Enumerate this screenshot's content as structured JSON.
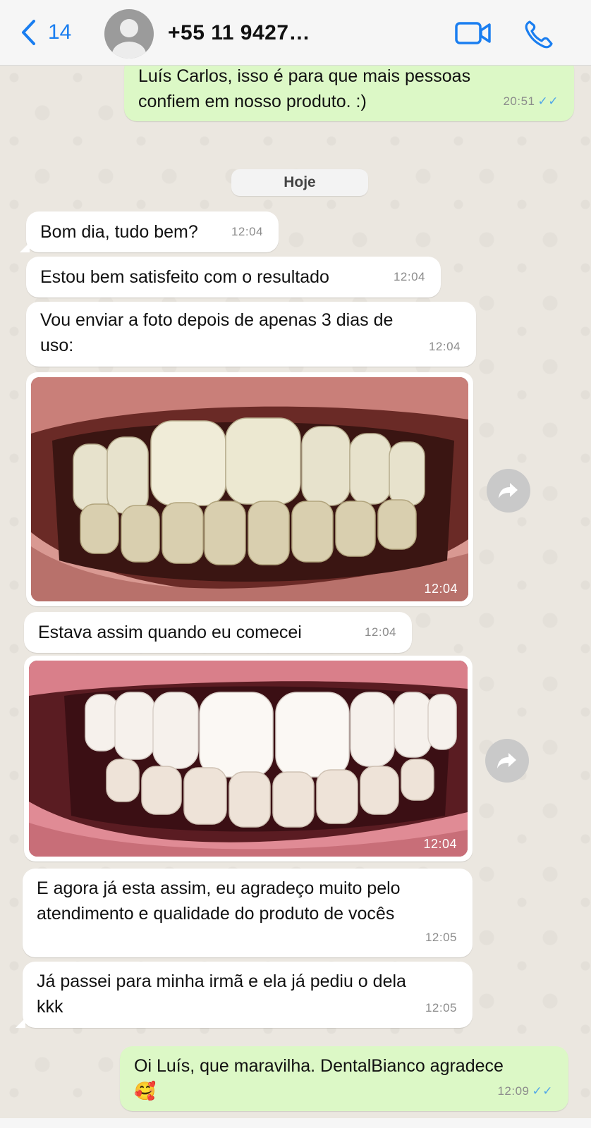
{
  "header": {
    "back_count": "14",
    "contact": "+55 11 9427…",
    "video_icon": "video-camera-icon",
    "phone_icon": "phone-icon"
  },
  "messages": {
    "m0": {
      "text_line1": "Luís Carlos, isso é para que mais pessoas",
      "text_line2": "confiem em nosso produto. :)",
      "time": "20:51",
      "ticks": "✓✓"
    },
    "date_chip": "Hoje",
    "m1": {
      "text": "Bom dia, tudo bem?",
      "time": "12:04"
    },
    "m2": {
      "text": "Estou bem satisfeito com o resultado",
      "time": "12:04"
    },
    "m3": {
      "text_line1": "Vou enviar a foto depois de apenas 3 dias de",
      "text_line2": "uso:",
      "time": "12:04"
    },
    "photo1": {
      "time": "12:04"
    },
    "m4": {
      "text": "Estava assim quando eu comecei",
      "time": "12:04"
    },
    "photo2": {
      "time": "12:04"
    },
    "m5": {
      "text_line1": "E agora já esta assim, eu agradeço muito pelo",
      "text_line2": "atendimento e qualidade do produto de vocês",
      "time": "12:05"
    },
    "m6": {
      "text_line1": "Já passei para minha irmã e ela já pediu o dela",
      "text_line2": "kkk",
      "time": "12:05"
    },
    "m7": {
      "text_line1": "Oi Luís, que maravilha. DentalBianco agradece",
      "emoji": "🥰",
      "time": "12:09",
      "ticks": "✓✓"
    }
  },
  "colors": {
    "accent": "#1a7ef0",
    "outgoing": "#dcf8c6",
    "incoming": "#ffffff",
    "read_ticks": "#4fa6e8"
  }
}
